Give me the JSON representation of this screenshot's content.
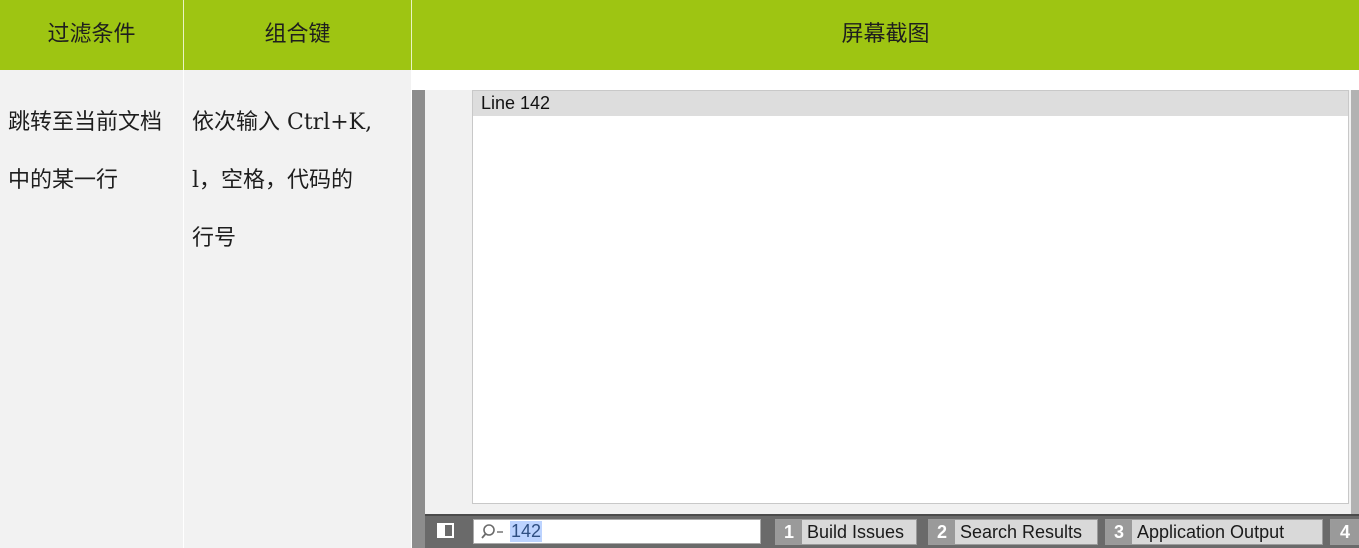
{
  "table": {
    "headers": {
      "filter": "过滤条件",
      "shortcut": "组合键",
      "screenshot": "屏幕截图"
    },
    "row": {
      "filter_text": "跳转至当前文档中的某一行",
      "shortcut_text": "依次输入 Ctrl+K,\nl，空格，代码的\n行号"
    }
  },
  "screenshot": {
    "locator_result": "Line 142",
    "search_value": "142",
    "tabs": [
      {
        "number": "1",
        "label": "Build Issues"
      },
      {
        "number": "2",
        "label": "Search Results"
      },
      {
        "number": "3",
        "label": "Application Output"
      },
      {
        "number": "4",
        "label": ""
      }
    ],
    "icons": {
      "sidebar": "sidebar-toggle-icon",
      "search": "search-icon"
    },
    "colors": {
      "header_green": "#9ec512",
      "cell_gray": "#f2f2f2",
      "toolbar_gray": "#6a6a6a",
      "selection_blue": "#bcd3ff"
    }
  }
}
